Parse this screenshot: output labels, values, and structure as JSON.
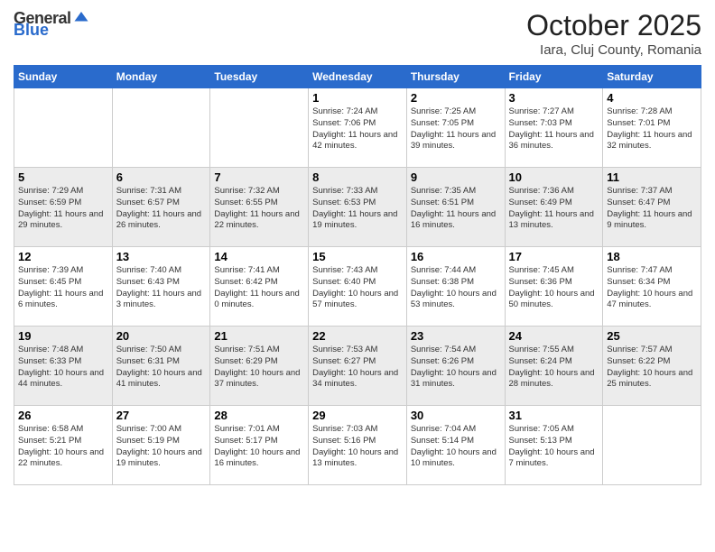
{
  "header": {
    "logo_general": "General",
    "logo_blue": "Blue",
    "month": "October 2025",
    "location": "Iara, Cluj County, Romania"
  },
  "weekdays": [
    "Sunday",
    "Monday",
    "Tuesday",
    "Wednesday",
    "Thursday",
    "Friday",
    "Saturday"
  ],
  "weeks": [
    [
      {
        "day": "",
        "sunrise": "",
        "sunset": "",
        "daylight": ""
      },
      {
        "day": "",
        "sunrise": "",
        "sunset": "",
        "daylight": ""
      },
      {
        "day": "",
        "sunrise": "",
        "sunset": "",
        "daylight": ""
      },
      {
        "day": "1",
        "sunrise": "Sunrise: 7:24 AM",
        "sunset": "Sunset: 7:06 PM",
        "daylight": "Daylight: 11 hours and 42 minutes."
      },
      {
        "day": "2",
        "sunrise": "Sunrise: 7:25 AM",
        "sunset": "Sunset: 7:05 PM",
        "daylight": "Daylight: 11 hours and 39 minutes."
      },
      {
        "day": "3",
        "sunrise": "Sunrise: 7:27 AM",
        "sunset": "Sunset: 7:03 PM",
        "daylight": "Daylight: 11 hours and 36 minutes."
      },
      {
        "day": "4",
        "sunrise": "Sunrise: 7:28 AM",
        "sunset": "Sunset: 7:01 PM",
        "daylight": "Daylight: 11 hours and 32 minutes."
      }
    ],
    [
      {
        "day": "5",
        "sunrise": "Sunrise: 7:29 AM",
        "sunset": "Sunset: 6:59 PM",
        "daylight": "Daylight: 11 hours and 29 minutes."
      },
      {
        "day": "6",
        "sunrise": "Sunrise: 7:31 AM",
        "sunset": "Sunset: 6:57 PM",
        "daylight": "Daylight: 11 hours and 26 minutes."
      },
      {
        "day": "7",
        "sunrise": "Sunrise: 7:32 AM",
        "sunset": "Sunset: 6:55 PM",
        "daylight": "Daylight: 11 hours and 22 minutes."
      },
      {
        "day": "8",
        "sunrise": "Sunrise: 7:33 AM",
        "sunset": "Sunset: 6:53 PM",
        "daylight": "Daylight: 11 hours and 19 minutes."
      },
      {
        "day": "9",
        "sunrise": "Sunrise: 7:35 AM",
        "sunset": "Sunset: 6:51 PM",
        "daylight": "Daylight: 11 hours and 16 minutes."
      },
      {
        "day": "10",
        "sunrise": "Sunrise: 7:36 AM",
        "sunset": "Sunset: 6:49 PM",
        "daylight": "Daylight: 11 hours and 13 minutes."
      },
      {
        "day": "11",
        "sunrise": "Sunrise: 7:37 AM",
        "sunset": "Sunset: 6:47 PM",
        "daylight": "Daylight: 11 hours and 9 minutes."
      }
    ],
    [
      {
        "day": "12",
        "sunrise": "Sunrise: 7:39 AM",
        "sunset": "Sunset: 6:45 PM",
        "daylight": "Daylight: 11 hours and 6 minutes."
      },
      {
        "day": "13",
        "sunrise": "Sunrise: 7:40 AM",
        "sunset": "Sunset: 6:43 PM",
        "daylight": "Daylight: 11 hours and 3 minutes."
      },
      {
        "day": "14",
        "sunrise": "Sunrise: 7:41 AM",
        "sunset": "Sunset: 6:42 PM",
        "daylight": "Daylight: 11 hours and 0 minutes."
      },
      {
        "day": "15",
        "sunrise": "Sunrise: 7:43 AM",
        "sunset": "Sunset: 6:40 PM",
        "daylight": "Daylight: 10 hours and 57 minutes."
      },
      {
        "day": "16",
        "sunrise": "Sunrise: 7:44 AM",
        "sunset": "Sunset: 6:38 PM",
        "daylight": "Daylight: 10 hours and 53 minutes."
      },
      {
        "day": "17",
        "sunrise": "Sunrise: 7:45 AM",
        "sunset": "Sunset: 6:36 PM",
        "daylight": "Daylight: 10 hours and 50 minutes."
      },
      {
        "day": "18",
        "sunrise": "Sunrise: 7:47 AM",
        "sunset": "Sunset: 6:34 PM",
        "daylight": "Daylight: 10 hours and 47 minutes."
      }
    ],
    [
      {
        "day": "19",
        "sunrise": "Sunrise: 7:48 AM",
        "sunset": "Sunset: 6:33 PM",
        "daylight": "Daylight: 10 hours and 44 minutes."
      },
      {
        "day": "20",
        "sunrise": "Sunrise: 7:50 AM",
        "sunset": "Sunset: 6:31 PM",
        "daylight": "Daylight: 10 hours and 41 minutes."
      },
      {
        "day": "21",
        "sunrise": "Sunrise: 7:51 AM",
        "sunset": "Sunset: 6:29 PM",
        "daylight": "Daylight: 10 hours and 37 minutes."
      },
      {
        "day": "22",
        "sunrise": "Sunrise: 7:53 AM",
        "sunset": "Sunset: 6:27 PM",
        "daylight": "Daylight: 10 hours and 34 minutes."
      },
      {
        "day": "23",
        "sunrise": "Sunrise: 7:54 AM",
        "sunset": "Sunset: 6:26 PM",
        "daylight": "Daylight: 10 hours and 31 minutes."
      },
      {
        "day": "24",
        "sunrise": "Sunrise: 7:55 AM",
        "sunset": "Sunset: 6:24 PM",
        "daylight": "Daylight: 10 hours and 28 minutes."
      },
      {
        "day": "25",
        "sunrise": "Sunrise: 7:57 AM",
        "sunset": "Sunset: 6:22 PM",
        "daylight": "Daylight: 10 hours and 25 minutes."
      }
    ],
    [
      {
        "day": "26",
        "sunrise": "Sunrise: 6:58 AM",
        "sunset": "Sunset: 5:21 PM",
        "daylight": "Daylight: 10 hours and 22 minutes."
      },
      {
        "day": "27",
        "sunrise": "Sunrise: 7:00 AM",
        "sunset": "Sunset: 5:19 PM",
        "daylight": "Daylight: 10 hours and 19 minutes."
      },
      {
        "day": "28",
        "sunrise": "Sunrise: 7:01 AM",
        "sunset": "Sunset: 5:17 PM",
        "daylight": "Daylight: 10 hours and 16 minutes."
      },
      {
        "day": "29",
        "sunrise": "Sunrise: 7:03 AM",
        "sunset": "Sunset: 5:16 PM",
        "daylight": "Daylight: 10 hours and 13 minutes."
      },
      {
        "day": "30",
        "sunrise": "Sunrise: 7:04 AM",
        "sunset": "Sunset: 5:14 PM",
        "daylight": "Daylight: 10 hours and 10 minutes."
      },
      {
        "day": "31",
        "sunrise": "Sunrise: 7:05 AM",
        "sunset": "Sunset: 5:13 PM",
        "daylight": "Daylight: 10 hours and 7 minutes."
      },
      {
        "day": "",
        "sunrise": "",
        "sunset": "",
        "daylight": ""
      }
    ]
  ]
}
